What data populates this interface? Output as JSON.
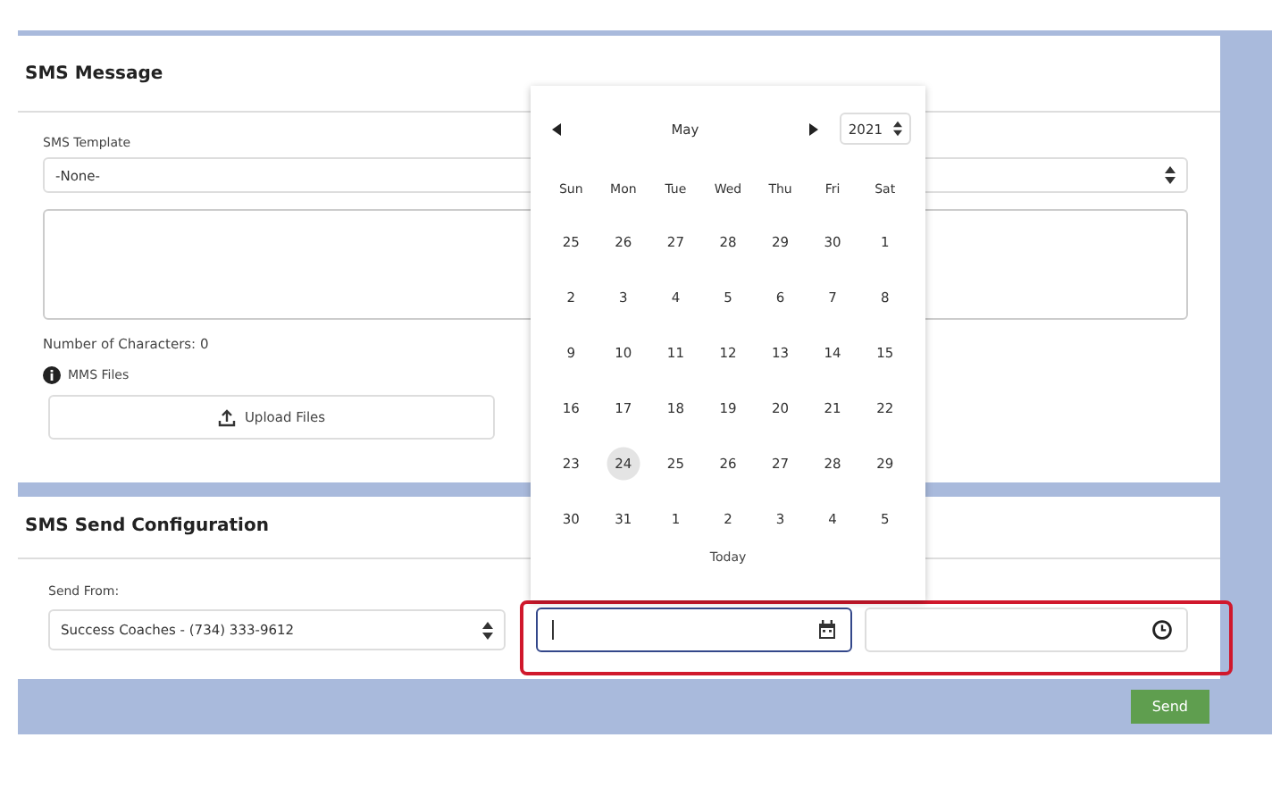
{
  "sms_message": {
    "title": "SMS Message",
    "template_label": "SMS Template",
    "template_value": "-None-",
    "character_count": "Number of Characters: 0",
    "mms_label": "MMS Files",
    "upload_button": "Upload Files"
  },
  "send_configuration": {
    "title": "SMS Send Configuration",
    "send_from_label": "Send From:",
    "send_from_value": "Success Coaches - (734) 333-9612"
  },
  "send_button": "Send",
  "date_picker": {
    "month": "May",
    "year": "2021",
    "today": "Today",
    "weekdays": [
      "Sun",
      "Mon",
      "Tue",
      "Wed",
      "Thu",
      "Fri",
      "Sat"
    ],
    "days": [
      {
        "label": "25",
        "selected": false
      },
      {
        "label": "26",
        "selected": false
      },
      {
        "label": "27",
        "selected": false
      },
      {
        "label": "28",
        "selected": false
      },
      {
        "label": "29",
        "selected": false
      },
      {
        "label": "30",
        "selected": false
      },
      {
        "label": "1",
        "selected": false
      },
      {
        "label": "2",
        "selected": false
      },
      {
        "label": "3",
        "selected": false
      },
      {
        "label": "4",
        "selected": false
      },
      {
        "label": "5",
        "selected": false
      },
      {
        "label": "6",
        "selected": false
      },
      {
        "label": "7",
        "selected": false
      },
      {
        "label": "8",
        "selected": false
      },
      {
        "label": "9",
        "selected": false
      },
      {
        "label": "10",
        "selected": false
      },
      {
        "label": "11",
        "selected": false
      },
      {
        "label": "12",
        "selected": false
      },
      {
        "label": "13",
        "selected": false
      },
      {
        "label": "14",
        "selected": false
      },
      {
        "label": "15",
        "selected": false
      },
      {
        "label": "16",
        "selected": false
      },
      {
        "label": "17",
        "selected": false
      },
      {
        "label": "18",
        "selected": false
      },
      {
        "label": "19",
        "selected": false
      },
      {
        "label": "20",
        "selected": false
      },
      {
        "label": "21",
        "selected": false
      },
      {
        "label": "22",
        "selected": false
      },
      {
        "label": "23",
        "selected": false
      },
      {
        "label": "24",
        "selected": true
      },
      {
        "label": "25",
        "selected": false
      },
      {
        "label": "26",
        "selected": false
      },
      {
        "label": "27",
        "selected": false
      },
      {
        "label": "28",
        "selected": false
      },
      {
        "label": "29",
        "selected": false
      },
      {
        "label": "30",
        "selected": false
      },
      {
        "label": "31",
        "selected": false
      },
      {
        "label": "1",
        "selected": false
      },
      {
        "label": "2",
        "selected": false
      },
      {
        "label": "3",
        "selected": false
      },
      {
        "label": "4",
        "selected": false
      },
      {
        "label": "5",
        "selected": false
      }
    ]
  }
}
